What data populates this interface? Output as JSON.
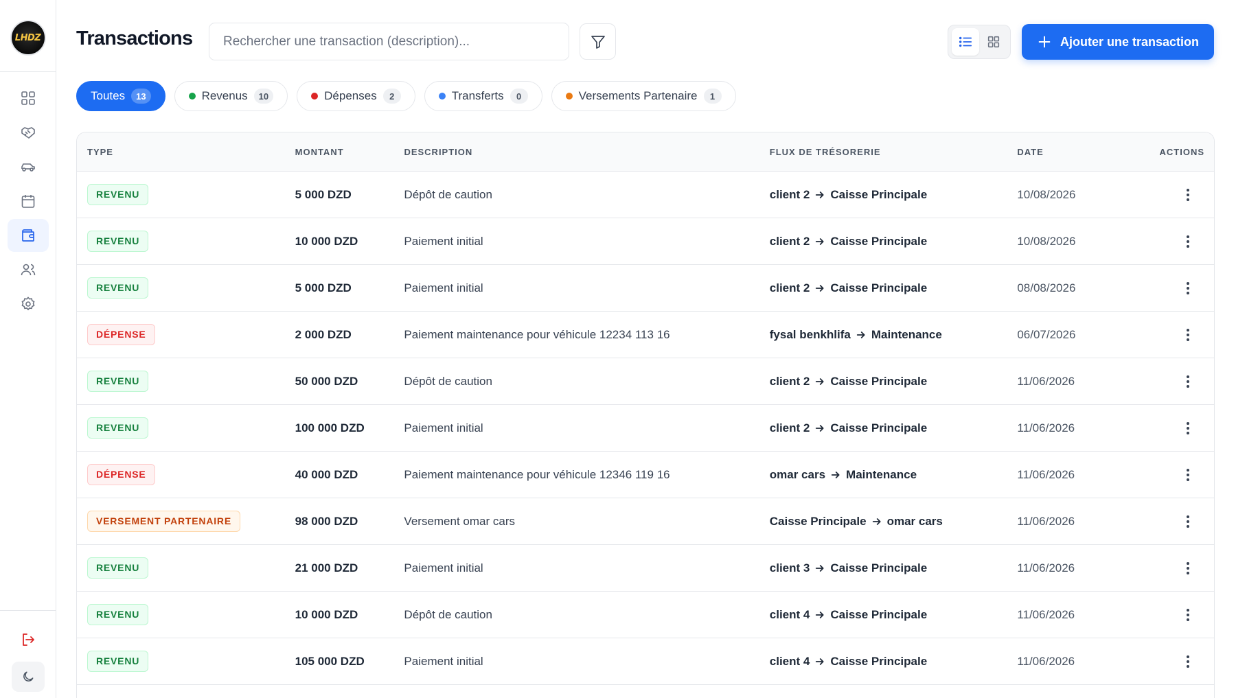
{
  "brand": {
    "logo_text": "LHDZ"
  },
  "sidebar": {
    "items": [
      {
        "name": "dashboard",
        "icon": "grid-icon",
        "active": false
      },
      {
        "name": "partners",
        "icon": "handshake-icon",
        "active": false
      },
      {
        "name": "vehicles",
        "icon": "car-icon",
        "active": false
      },
      {
        "name": "calendar",
        "icon": "calendar-icon",
        "active": false
      },
      {
        "name": "transactions",
        "icon": "wallet-icon",
        "active": true
      },
      {
        "name": "clients",
        "icon": "users-icon",
        "active": false
      },
      {
        "name": "settings",
        "icon": "gear-icon",
        "active": false
      }
    ],
    "logout_icon": "logout-icon",
    "theme_icon": "moon-icon"
  },
  "header": {
    "title": "Transactions",
    "search_placeholder": "Rechercher une transaction (description)...",
    "add_label": "Ajouter une transaction"
  },
  "filters": [
    {
      "label": "Toutes",
      "count": "13",
      "active": true,
      "color": ""
    },
    {
      "label": "Revenus",
      "count": "10",
      "active": false,
      "color": "#16a34a"
    },
    {
      "label": "Dépenses",
      "count": "2",
      "active": false,
      "color": "#dc2626"
    },
    {
      "label": "Transferts",
      "count": "0",
      "active": false,
      "color": "#3b82f6"
    },
    {
      "label": "Versements Partenaire",
      "count": "1",
      "active": false,
      "color": "#ea7a12"
    }
  ],
  "table": {
    "headers": {
      "type": "TYPE",
      "amount": "MONTANT",
      "description": "DESCRIPTION",
      "flux": "FLUX DE TRÉSORERIE",
      "date": "DATE",
      "actions": "ACTIONS"
    },
    "rows": [
      {
        "type": "REVENU",
        "kind": "revenu",
        "amount": "5 000 DZD",
        "description": "Dépôt de caution",
        "from": "client 2",
        "to": "Caisse Principale",
        "date": "10/08/2026"
      },
      {
        "type": "REVENU",
        "kind": "revenu",
        "amount": "10 000 DZD",
        "description": "Paiement initial",
        "from": "client 2",
        "to": "Caisse Principale",
        "date": "10/08/2026"
      },
      {
        "type": "REVENU",
        "kind": "revenu",
        "amount": "5 000 DZD",
        "description": "Paiement initial",
        "from": "client 2",
        "to": "Caisse Principale",
        "date": "08/08/2026"
      },
      {
        "type": "DÉPENSE",
        "kind": "depense",
        "amount": "2 000 DZD",
        "description": "Paiement maintenance pour véhicule 12234 113 16",
        "from": "fysal benkhlifa",
        "to": "Maintenance",
        "date": "06/07/2026"
      },
      {
        "type": "REVENU",
        "kind": "revenu",
        "amount": "50 000 DZD",
        "description": "Dépôt de caution",
        "from": "client 2",
        "to": "Caisse Principale",
        "date": "11/06/2026"
      },
      {
        "type": "REVENU",
        "kind": "revenu",
        "amount": "100 000 DZD",
        "description": "Paiement initial",
        "from": "client 2",
        "to": "Caisse Principale",
        "date": "11/06/2026"
      },
      {
        "type": "DÉPENSE",
        "kind": "depense",
        "amount": "40 000 DZD",
        "description": "Paiement maintenance pour véhicule 12346 119 16",
        "from": "omar cars",
        "to": "Maintenance",
        "date": "11/06/2026"
      },
      {
        "type": "VERSEMENT PARTENAIRE",
        "kind": "versement",
        "amount": "98 000 DZD",
        "description": "Versement omar cars",
        "from": "Caisse Principale",
        "to": "omar cars",
        "date": "11/06/2026"
      },
      {
        "type": "REVENU",
        "kind": "revenu",
        "amount": "21 000 DZD",
        "description": "Paiement initial",
        "from": "client 3",
        "to": "Caisse Principale",
        "date": "11/06/2026"
      },
      {
        "type": "REVENU",
        "kind": "revenu",
        "amount": "10 000 DZD",
        "description": "Dépôt de caution",
        "from": "client 4",
        "to": "Caisse Principale",
        "date": "11/06/2026"
      },
      {
        "type": "REVENU",
        "kind": "revenu",
        "amount": "105 000 DZD",
        "description": "Paiement initial",
        "from": "client 4",
        "to": "Caisse Principale",
        "date": "11/06/2026"
      }
    ]
  },
  "colors": {
    "accent": "#1d6cf2",
    "revenu": "#15803d",
    "depense": "#dc2626",
    "versement": "#c2410c"
  }
}
